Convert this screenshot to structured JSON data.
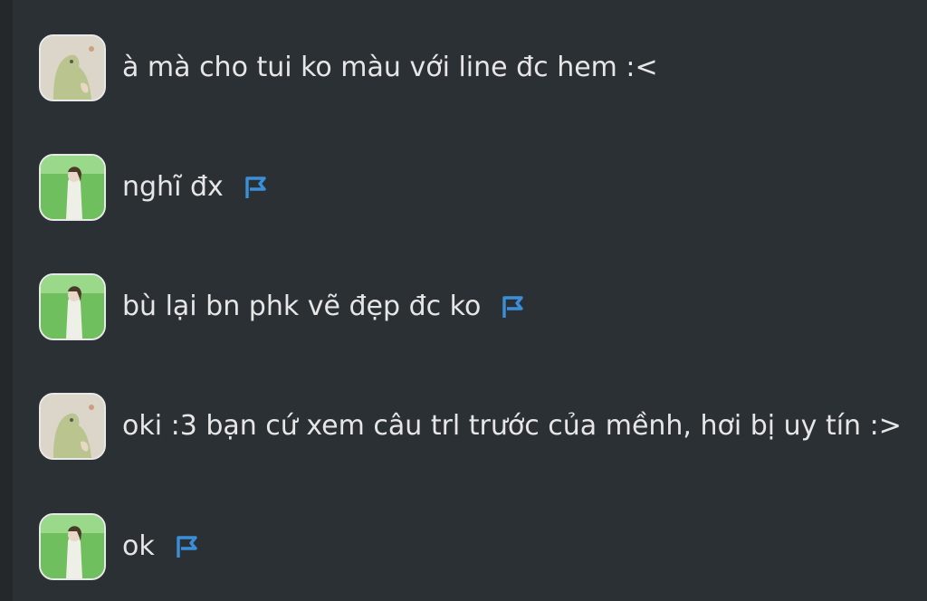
{
  "messages": [
    {
      "avatar": "dino-avatar",
      "text": "à mà cho tui ko màu với line đc hem :<",
      "flag": false
    },
    {
      "avatar": "girl-avatar",
      "text": "nghĩ đx",
      "flag": true
    },
    {
      "avatar": "girl-avatar",
      "text": "bù lại bn phk vẽ đẹp đc ko",
      "flag": true
    },
    {
      "avatar": "dino-avatar",
      "text": "oki :3 bạn cứ xem câu trl trước của mềnh, hơi bị uy tín :>",
      "flag": false
    },
    {
      "avatar": "girl-avatar",
      "text": "ok",
      "flag": true
    }
  ],
  "colors": {
    "background": "#2b3035",
    "text": "#e6e6e6",
    "flag": "#3a8fd8"
  }
}
